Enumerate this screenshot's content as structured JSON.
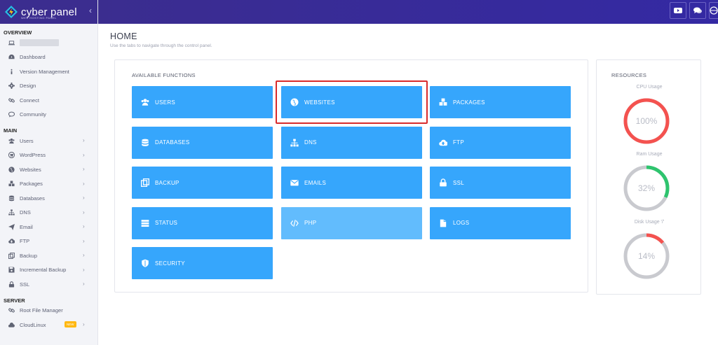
{
  "brand": {
    "name": "cyber panel",
    "tagline": "WEB HOSTING PANEL"
  },
  "sidebar": {
    "overview_label": "OVERVIEW",
    "main_label": "MAIN",
    "server_label": "SERVER",
    "overview_items": [
      {
        "label": "Dashboard",
        "icon": "dashboard-icon"
      },
      {
        "label": "Version Management",
        "icon": "info-icon"
      },
      {
        "label": "Design",
        "icon": "gear-icon"
      },
      {
        "label": "Connect",
        "icon": "link-icon"
      },
      {
        "label": "Community",
        "icon": "chat-icon"
      }
    ],
    "main_items": [
      {
        "label": "Users",
        "icon": "users-icon"
      },
      {
        "label": "WordPress",
        "icon": "wordpress-icon"
      },
      {
        "label": "Websites",
        "icon": "globe-icon"
      },
      {
        "label": "Packages",
        "icon": "cubes-icon"
      },
      {
        "label": "Databases",
        "icon": "database-icon"
      },
      {
        "label": "DNS",
        "icon": "sitemap-icon"
      },
      {
        "label": "Email",
        "icon": "paper-plane-icon"
      },
      {
        "label": "FTP",
        "icon": "cloud-upload-icon"
      },
      {
        "label": "Backup",
        "icon": "backup-icon"
      },
      {
        "label": "Incremental Backup",
        "icon": "save-icon"
      },
      {
        "label": "SSL",
        "icon": "lock-icon"
      }
    ],
    "server_items": [
      {
        "label": "Root File Manager",
        "icon": "link-icon"
      },
      {
        "label": "CloudLinux",
        "icon": "cloudlinux-icon",
        "badge": "NEW"
      }
    ]
  },
  "topbar": {
    "buttons": [
      "youtube-icon",
      "comments-icon",
      "globe-icon"
    ]
  },
  "header": {
    "title": "HOME",
    "subtitle": "Use the tabs to navigate through the control panel."
  },
  "functions": {
    "title": "AVAILABLE FUNCTIONS",
    "tiles": [
      {
        "label": "USERS",
        "icon": "users-icon"
      },
      {
        "label": "WEBSITES",
        "icon": "globe-icon"
      },
      {
        "label": "PACKAGES",
        "icon": "cubes-icon"
      },
      {
        "label": "DATABASES",
        "icon": "database-icon"
      },
      {
        "label": "DNS",
        "icon": "sitemap-icon"
      },
      {
        "label": "FTP",
        "icon": "cloud-upload-icon"
      },
      {
        "label": "BACKUP",
        "icon": "backup-icon"
      },
      {
        "label": "EMAILS",
        "icon": "envelope-icon"
      },
      {
        "label": "SSL",
        "icon": "lock-icon"
      },
      {
        "label": "STATUS",
        "icon": "server-icon"
      },
      {
        "label": "PHP",
        "icon": "code-icon"
      },
      {
        "label": "LOGS",
        "icon": "file-icon"
      },
      {
        "label": "SECURITY",
        "icon": "shield-icon"
      }
    ]
  },
  "resources": {
    "title": "RESOURCES",
    "gauges": [
      {
        "label": "CPU Usage",
        "value": 100,
        "value_text": "100%",
        "color": "#f4524f"
      },
      {
        "label": "Ram Usage",
        "value": 32,
        "value_text": "32%",
        "color": "#2ec46e"
      },
      {
        "label": "Disk Usage '/'",
        "value": 14,
        "value_text": "14%",
        "color": "#f4524f"
      }
    ],
    "track_color": "#c9cacf"
  },
  "colors": {
    "tile": "#36a6fc",
    "tile_light": "#62bcfd",
    "sidebar_bg": "#f3f4f8",
    "brand_bg": "#3b2d8f"
  }
}
